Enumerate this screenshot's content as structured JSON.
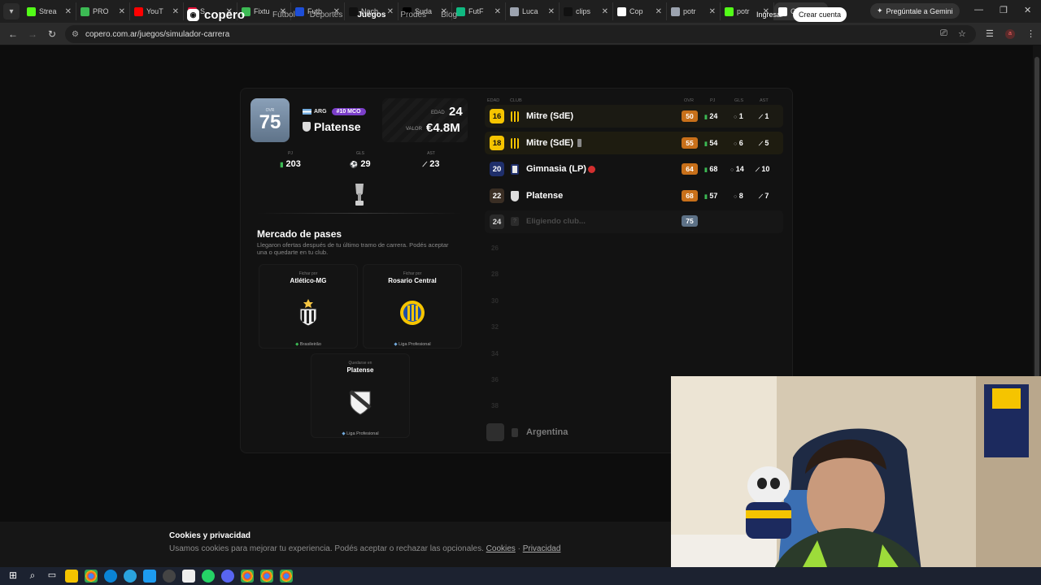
{
  "browser": {
    "tabs": [
      {
        "title": "Strea",
        "color": "#53fc18"
      },
      {
        "title": "PRO",
        "color": "#3cba54"
      },
      {
        "title": "YouT",
        "color": "#ff0000"
      },
      {
        "title": "S",
        "color": "#e3143b"
      },
      {
        "title": "Fixtu",
        "color": "#3cba54"
      },
      {
        "title": "Futb",
        "color": "#1d4ed8"
      },
      {
        "title": "Nach",
        "color": "#111111"
      },
      {
        "title": "Suda",
        "color": "#000000"
      },
      {
        "title": "FutF",
        "color": "#10b981"
      },
      {
        "title": "Luca",
        "color": "#9ca3af"
      },
      {
        "title": "clips",
        "color": "#111111"
      },
      {
        "title": "Cop",
        "color": "#ffffff"
      },
      {
        "title": "potr",
        "color": "#9ca3af"
      },
      {
        "title": "potr",
        "color": "#53fc18"
      },
      {
        "title": "Cop",
        "color": "#ffffff"
      }
    ],
    "gemini_label": "Pregúntale a Gemini",
    "url": "copero.com.ar/juegos/simulador-carrera",
    "profile_initial": "a"
  },
  "site": {
    "logo": "copero",
    "nav": [
      "Fútbol",
      "Deportes",
      "Juegos",
      "Prodes",
      "Blog"
    ],
    "login": "Ingresar",
    "signup": "Crear cuenta"
  },
  "player": {
    "ovr_label": "OVR",
    "ovr": "75",
    "nation": "ARG",
    "position": "#10 MCO",
    "club": "Platense",
    "age_label": "EDAD",
    "age": "24",
    "value_label": "VALOR",
    "value": "€4.8M",
    "stats": [
      {
        "key": "PJ",
        "value": "203",
        "icon": "▮"
      },
      {
        "key": "GLS",
        "value": "29",
        "icon": "⚽"
      },
      {
        "key": "AST",
        "value": "23",
        "icon": "👟"
      }
    ]
  },
  "market": {
    "title": "Mercado de pases",
    "description": "Llegaron ofertas después de tu último tramo de carrera. Podés aceptar una o quedarte en tu club.",
    "offers": [
      {
        "kind": "Fichar por",
        "club": "Atlético-MG",
        "league": "Brasileirão"
      },
      {
        "kind": "Fichar por",
        "club": "Rosario Central",
        "league": "Liga Profesional"
      },
      {
        "kind": "Quedarse en",
        "club": "Platense",
        "league": "Liga Profesional"
      }
    ]
  },
  "career": {
    "headers": {
      "age": "EDAD",
      "club": "CLUB",
      "ovr": "OVR",
      "pj": "PJ",
      "gls": "GLS",
      "ast": "AST"
    },
    "rows": [
      {
        "age": "16",
        "club": "Mitre (SdE)",
        "ovr": "50",
        "pj": "24",
        "gls": "1",
        "ast": "1"
      },
      {
        "age": "18",
        "club": "Mitre (SdE)",
        "ovr": "55",
        "pj": "54",
        "gls": "6",
        "ast": "5"
      },
      {
        "age": "20",
        "club": "Gimnasia (LP)",
        "ovr": "64",
        "pj": "68",
        "gls": "14",
        "ast": "10"
      },
      {
        "age": "22",
        "club": "Platense",
        "ovr": "68",
        "pj": "57",
        "gls": "8",
        "ast": "7"
      }
    ],
    "current": {
      "age": "24",
      "club": "Eligiendo club...",
      "ovr": "75"
    },
    "future_ages": [
      "26",
      "28",
      "30",
      "32",
      "34",
      "36",
      "38"
    ],
    "country": "Argentina"
  },
  "cookies": {
    "title": "Cookies y privacidad",
    "text": "Usamos cookies para mejorar tu experiencia. Podés aceptar o rechazar las opcionales.",
    "link1": "Cookies",
    "sep": "·",
    "link2": "Privacidad"
  }
}
